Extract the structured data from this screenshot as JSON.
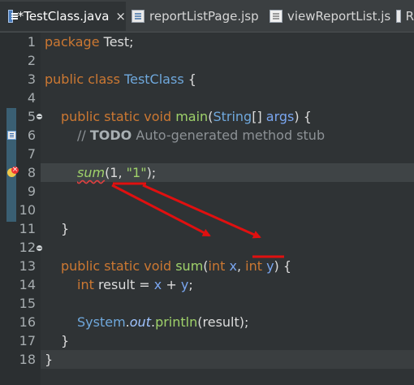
{
  "tabs": [
    {
      "label": "*TestClass.java",
      "icon": "java-file-icon",
      "active": true
    },
    {
      "label": "reportListPage.jsp",
      "icon": "jsp-file-icon",
      "active": false
    },
    {
      "label": "viewReportList.js",
      "icon": "js-file-icon",
      "active": false
    },
    {
      "label": "R",
      "icon": "file-icon",
      "active": false
    }
  ],
  "close_glyph": "×",
  "line_numbers": [
    "1",
    "2",
    "3",
    "4",
    "5",
    "6",
    "7",
    "8",
    "9",
    "10",
    "11",
    "12",
    "13",
    "14",
    "15",
    "16",
    "17",
    "18"
  ],
  "code": {
    "l1": {
      "kw": "package",
      "rest": " Test;"
    },
    "l3": {
      "kw1": "public",
      "kw2": "class",
      "cls": "TestClass",
      "rest": " {"
    },
    "l5": {
      "kw1": "public",
      "kw2": "static",
      "kw3": "void",
      "fn": "main",
      "p1": "(",
      "type": "String",
      "p2": "[] ",
      "param": "args",
      "p3": ") {"
    },
    "l6": {
      "cmt1": "// ",
      "todo": "TODO",
      "cmt2": " Auto-generated method stub"
    },
    "l8": {
      "fn": "sum",
      "p1": "(1, ",
      "str": "\"1\"",
      "p2": ");"
    },
    "l10": {
      "text": "}"
    },
    "l12": {
      "kw1": "public",
      "kw2": "static",
      "kw3": "void",
      "fn": "sum",
      "p1": "(",
      "t1": "int",
      "x": "x",
      "comma": ", ",
      "t2": "int",
      "y": "y",
      "p2": ") {"
    },
    "l13": {
      "t": "int",
      "v": "result",
      "eq": " = ",
      "x": "x",
      "plus": " + ",
      "y": "y",
      "end": ";"
    },
    "l15": {
      "cls": "System",
      "dot1": ".",
      "out": "out",
      "dot2": ".",
      "fn": "println",
      "args": "(result);"
    },
    "l16": {
      "text": "}"
    },
    "l17": {
      "text": "}"
    }
  },
  "colors": {
    "keyword": "#cc7832",
    "type": "#6fa8dc",
    "method": "#9fd26a",
    "string": "#9fd26a",
    "comment": "#8d9296",
    "annotation_red": "#e01010"
  }
}
